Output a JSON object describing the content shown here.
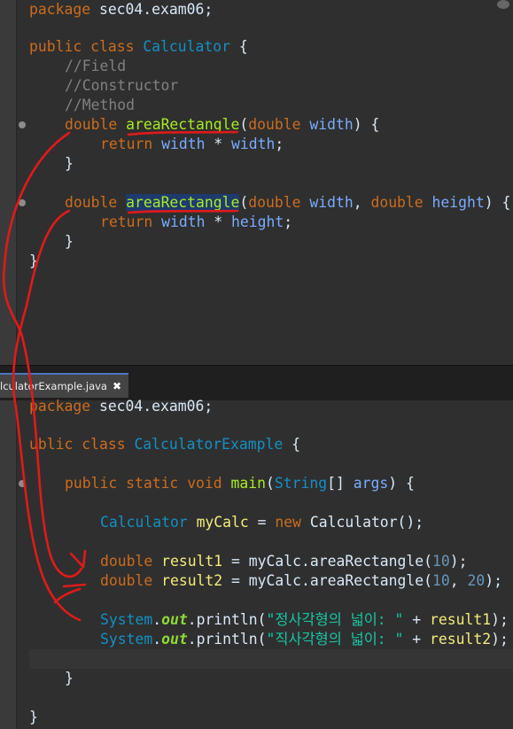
{
  "top_editor": {
    "lines": {
      "l1": {
        "kw": "package",
        "rest": " sec04.exam06;"
      },
      "l3": {
        "kw1": "public",
        "kw2": "class",
        "cls": "Calculator",
        "brace": "{"
      },
      "l4": "//Field",
      "l5": "//Constructor",
      "l6": "//Method",
      "l7": {
        "type": "double",
        "name": "areaRectangle",
        "p_open": "(",
        "ptype": "double",
        "pname": "width",
        "tail": ") {"
      },
      "l8": {
        "kw": "return",
        "a": "width",
        "op": " * ",
        "b": "width",
        "semi": ";"
      },
      "l9": "}",
      "l11": {
        "type": "double",
        "name": "areaRectangle",
        "p_open": "(",
        "ptype1": "double",
        "pname1": "width",
        "sep": ", ",
        "ptype2": "double",
        "pname2": "height",
        "tail": ") {"
      },
      "l12": {
        "kw": "return",
        "a": "width",
        "op": " * ",
        "b": "height",
        "semi": ";"
      },
      "l13": "}",
      "l14": "}"
    }
  },
  "tab": {
    "label": "lculatorExample.java",
    "close": "✖"
  },
  "bottom_editor": {
    "lines": {
      "l1": {
        "kw": "package",
        "rest": " sec04.exam06;"
      },
      "l3": {
        "kw1": "ublic",
        "kw2": "class",
        "cls": "CalculatorExample",
        "brace": "{"
      },
      "l5": {
        "kw1": "public",
        "kw2": "static",
        "kw3": "void",
        "name": "main",
        "p_open": "(",
        "ptype": "String",
        "arr": "[] ",
        "pname": "args",
        "tail": ") {"
      },
      "l7": {
        "cls": "Calculator",
        "var": "myCalc",
        "eq": " = ",
        "kw": "new",
        "ctor": " Calculator();"
      },
      "l9": {
        "type": "double",
        "var": "result1",
        "eq": " = ",
        "call": "myCalc.",
        "mtd": "areaRectangle",
        "args_open": "(",
        "n1": "10",
        "close": ");"
      },
      "l10": {
        "type": "double",
        "var": "result2",
        "eq": " = ",
        "call": "myCalc.",
        "mtd": "areaRectangle",
        "args_open": "(",
        "n1": "10",
        "sep": ", ",
        "n2": "20",
        "close": ");"
      },
      "l12": {
        "sys": "System",
        "dot": ".",
        "out": "out",
        "println": ".println(",
        "str": "\"정사각형의 넓이: \"",
        "plus": " + ",
        "var": "result1",
        "close": ");"
      },
      "l13": {
        "sys": "System",
        "dot": ".",
        "out": "out",
        "println": ".println(",
        "str": "\"직사각형의 넓이: \"",
        "plus": " + ",
        "var": "result2",
        "close": ");"
      },
      "l15": "}",
      "l17": "}"
    }
  },
  "colors": {
    "keyword": "#cc6c1d",
    "class": "#1290c3",
    "comment": "#808080",
    "method": "#a7ec21",
    "annotation": "#e01a1a"
  }
}
